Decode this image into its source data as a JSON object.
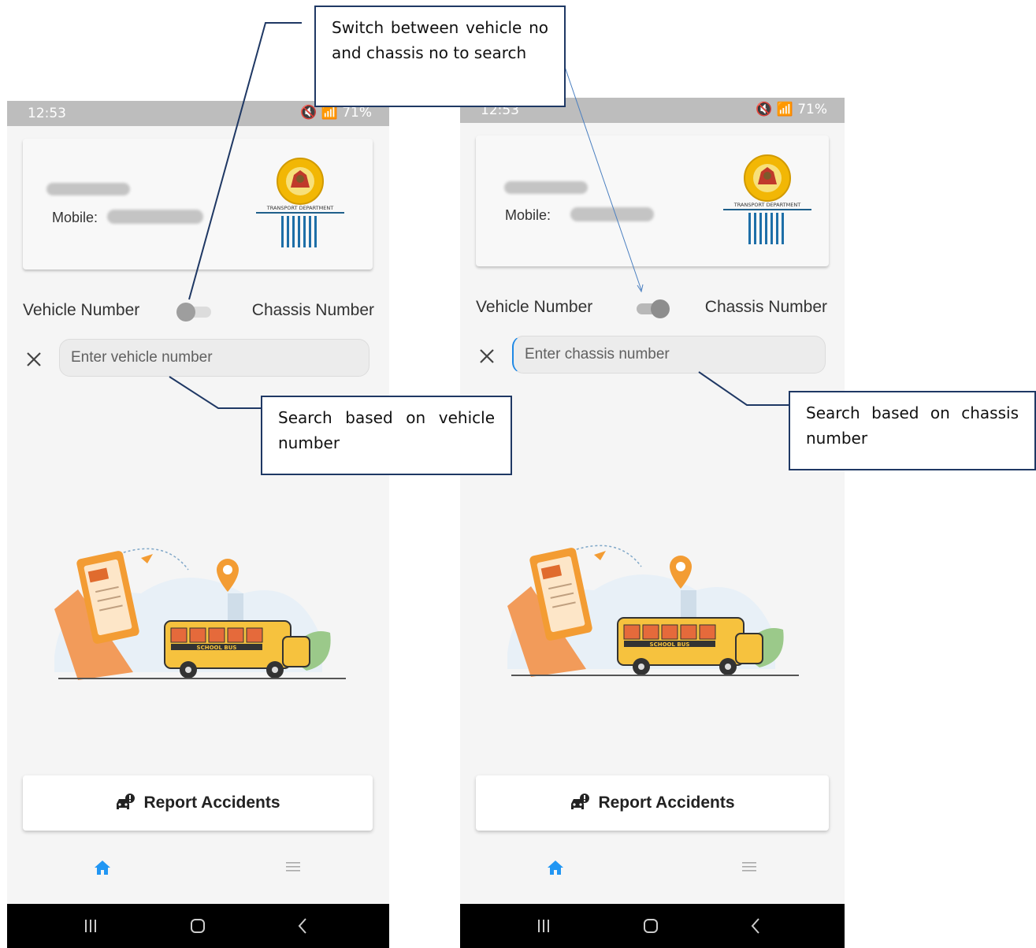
{
  "screens": [
    {
      "status": {
        "time": "12:53",
        "indicators": "71%"
      },
      "card": {
        "mobile_label": "Mobile:",
        "logo_text": "TRANSPORT DEPARTMENT"
      },
      "toggle": {
        "left_label": "Vehicle Number",
        "right_label": "Chassis Number",
        "state": "off"
      },
      "search": {
        "placeholder": "Enter vehicle number"
      },
      "report_button": {
        "label": "Report Accidents"
      }
    },
    {
      "status": {
        "time": "12:53",
        "indicators": "71%"
      },
      "card": {
        "mobile_label": "Mobile:",
        "logo_text": "TRANSPORT DEPARTMENT"
      },
      "toggle": {
        "left_label": "Vehicle Number",
        "right_label": "Chassis Number",
        "state": "on"
      },
      "search": {
        "placeholder": "Enter chassis number"
      },
      "report_button": {
        "label": "Report Accidents"
      }
    }
  ],
  "illustration": {
    "bus_text": "SCHOOL BUS"
  },
  "annotations": {
    "toggle_note": "Switch between vehicle no and chassis no to search",
    "vehicle_search_note": "Search based on vehicle number",
    "chassis_search_note": "Search based on chassis number"
  },
  "colors": {
    "accent": "#2196f3",
    "annotation_border": "#1f3864",
    "pin_orange": "#f39c33",
    "bus_yellow": "#f6c23e"
  }
}
